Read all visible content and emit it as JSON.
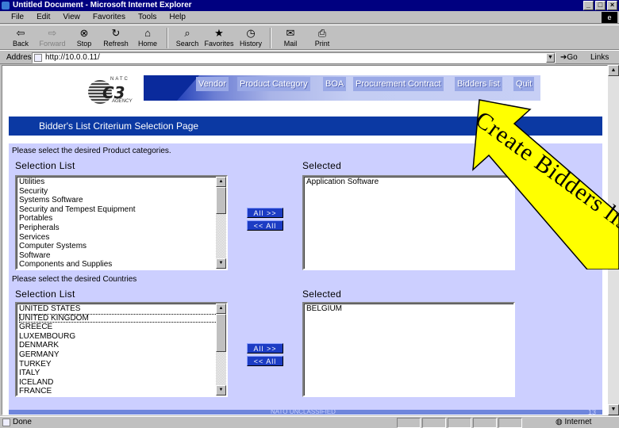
{
  "window": {
    "title": "Untitled Document - Microsoft Internet Explorer",
    "controls": [
      "_",
      "□",
      "×"
    ]
  },
  "menu": [
    "File",
    "Edit",
    "View",
    "Favorites",
    "Tools",
    "Help"
  ],
  "toolbar": [
    {
      "label": "Back",
      "icon": "back-arrow-icon",
      "glyph": "⇦",
      "enabled": true
    },
    {
      "label": "Forward",
      "icon": "forward-arrow-icon",
      "glyph": "⇨",
      "enabled": false
    },
    {
      "label": "Stop",
      "icon": "stop-icon",
      "glyph": "⊗",
      "enabled": true
    },
    {
      "label": "Refresh",
      "icon": "refresh-icon",
      "glyph": "↻",
      "enabled": true
    },
    {
      "label": "Home",
      "icon": "home-icon",
      "glyph": "⌂",
      "enabled": true
    },
    {
      "label": "Search",
      "icon": "search-icon",
      "glyph": "⌕",
      "enabled": true
    },
    {
      "label": "Favorites",
      "icon": "favorites-icon",
      "glyph": "★",
      "enabled": true
    },
    {
      "label": "History",
      "icon": "history-icon",
      "glyph": "◷",
      "enabled": true
    },
    {
      "label": "Mail",
      "icon": "mail-icon",
      "glyph": "✉",
      "enabled": true
    },
    {
      "label": "Print",
      "icon": "print-icon",
      "glyph": "⎙",
      "enabled": true
    }
  ],
  "address": {
    "label": "Address",
    "url": "http://10.0.0.11/",
    "go": "Go",
    "links": "Links"
  },
  "site": {
    "logo_natc": "NATC",
    "logo_c3": "C3",
    "logo_agency": "AGENCY",
    "nav": [
      "Vendor",
      "Product Category",
      "BOA",
      "Procurement Contract",
      "Bidders list",
      "Quit"
    ],
    "page_title": "Bidder's List Criterium Selection Page"
  },
  "product_section": {
    "prompt": "Please select the desired Product categories.",
    "list_header": "Selection List",
    "selected_header": "Selected",
    "items": [
      "Utilities",
      "Security",
      "Systems Software",
      "Security and Tempest Equipment",
      "Portables",
      "Peripherals",
      "Services",
      "Computer Systems",
      "Software",
      "Components and Supplies"
    ],
    "selected": [
      "Application Software"
    ],
    "add_all": "All >>",
    "remove_all": "<< All"
  },
  "country_section": {
    "prompt": "Please select the desired Countries",
    "list_header": "Selection List",
    "selected_header": "Selected",
    "items": [
      "UNITED STATES",
      "UNITED KINGDOM",
      "GREECE",
      "LUXEMBOURG",
      "DENMARK",
      "GERMANY",
      "TURKEY",
      "ITALY",
      "ICELAND",
      "FRANCE"
    ],
    "focused_index": 1,
    "selected": [
      "BELGIUM"
    ],
    "add_all": "All >>",
    "remove_all": "<< All"
  },
  "footer": {
    "text": "NATO UNCLASSIFIED",
    "page_number": "13"
  },
  "status": {
    "text": "Done",
    "zone": "Internet"
  },
  "annotation": {
    "text": "Create Bidders list",
    "color": "#ffff00"
  }
}
